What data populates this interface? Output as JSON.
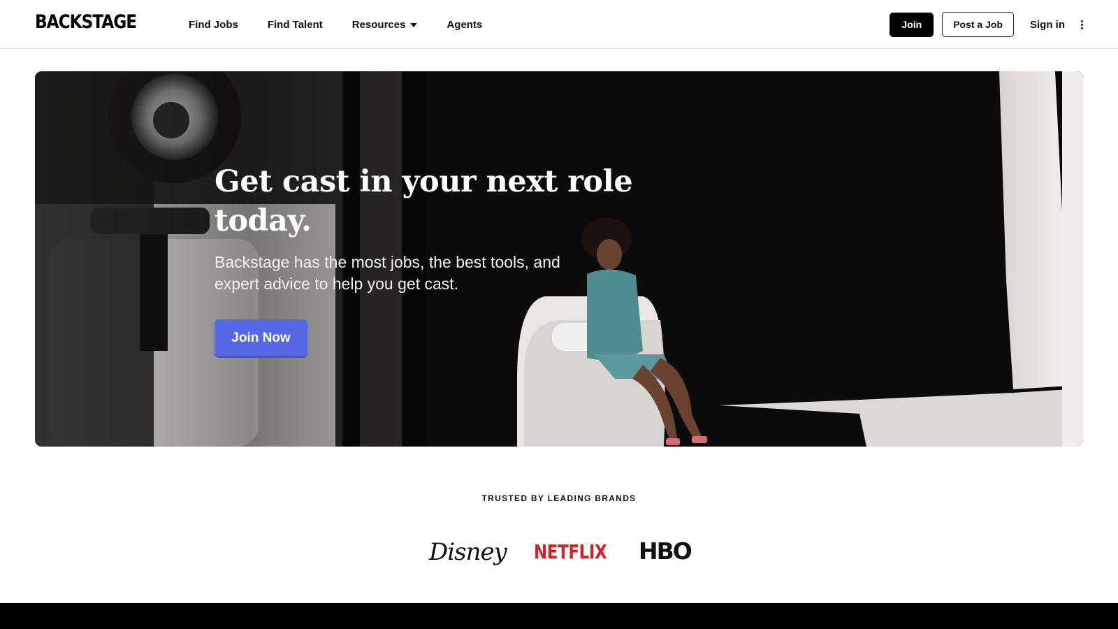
{
  "header": {
    "logo": "BACKSTAGE",
    "nav": [
      {
        "label": "Find Jobs"
      },
      {
        "label": "Find Talent"
      },
      {
        "label": "Resources"
      },
      {
        "label": "Agents"
      }
    ],
    "join_label": "Join",
    "post_job_label": "Post a Job",
    "sign_in_label": "Sign in"
  },
  "hero": {
    "title": "Get cast in your next role today.",
    "subtitle": "Backstage has the most jobs, the best tools, and expert advice to help you get cast.",
    "cta_label": "Join Now",
    "cta_color": "#5468e8"
  },
  "brands": {
    "heading": "TRUSTED BY LEADING BRANDS",
    "logos": [
      {
        "name": "Disney"
      },
      {
        "name": "NETFLIX",
        "color": "#d81f26"
      },
      {
        "name": "HBO"
      }
    ]
  }
}
